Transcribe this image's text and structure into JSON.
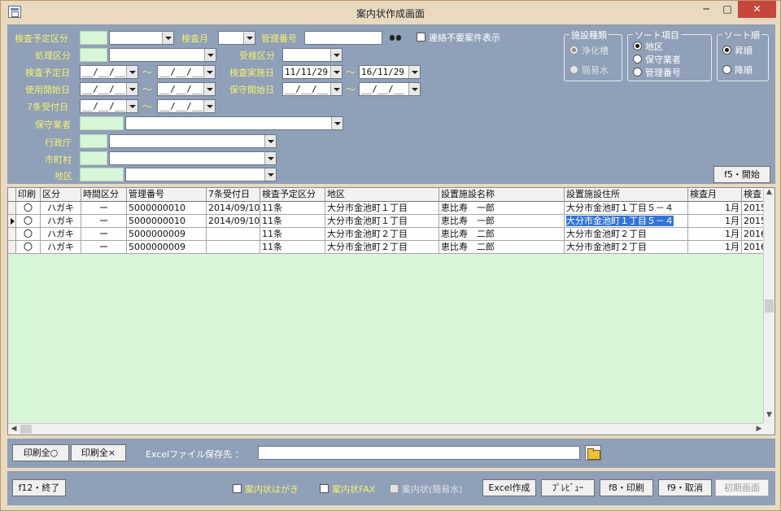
{
  "window": {
    "title": "案内状作成画面",
    "min_label": "─",
    "max_label": "□",
    "close_label": "✕"
  },
  "search": {
    "kensa_yotei_kubun": "検査予定区分",
    "kensa_tsuki": "検査月",
    "kanri_bangou": "管理番号",
    "renraku_fuyou": "連絡不要案件表示",
    "shori_kubun": "処理区分",
    "juken_kubun": "受検区分",
    "kensa_yotei_bi": "検査予定日",
    "kensa_jisshi_bi": "検査実施日",
    "shiyou_kaishi_bi": "使用開始日",
    "hoshu_kaishi_bi": "保守開始日",
    "nanajou_uketsuke_bi": "7条受付日",
    "hoshu_gyousha": "保守業者",
    "gyouseichou": "行政庁",
    "shichouson": "市町村",
    "chiku": "地区",
    "blank_date": "__/__/__",
    "jisshi_from": "11/11/29",
    "jisshi_to": "16/11/29",
    "tilde": "～"
  },
  "shisetsu_group": {
    "title": "施設種類",
    "options": [
      "浄化槽",
      "簡易水"
    ]
  },
  "sort_group": {
    "title": "ソート項目",
    "options": [
      "地区",
      "保守業者",
      "管理番号"
    ]
  },
  "order_group": {
    "title": "ソート順",
    "options": [
      "昇順",
      "降順"
    ]
  },
  "buttons": {
    "start": "f5・開始",
    "print_all_on": "印刷全○",
    "print_all_off": "印刷全×",
    "end": "f12・終了",
    "excel": "Excel作成",
    "preview": "ﾌﾟﾚﾋﾞｭｰ",
    "print": "f8・印刷",
    "cancel": "f9・取消",
    "init": "初期画面"
  },
  "excel": {
    "label": "Excelファイル保存先 ：",
    "value": ""
  },
  "footer_checks": [
    "案内状はがき",
    "案内状FAX",
    "案内状(簡易水)"
  ],
  "grid": {
    "columns": [
      "印刷",
      "区分",
      "時間区分",
      "管理番号",
      "7条受付日",
      "検査予定区分",
      "地区",
      "設置施設名称",
      "設置施設住所",
      "検査月",
      "検査"
    ],
    "rows": [
      [
        "〇",
        "ハガキ",
        "ー",
        "5000000010",
        "2014/09/10",
        "11条",
        "大分市金池町１丁目",
        "恵比寿　一郎",
        "大分市金池町１丁目５－４",
        "1月",
        "2015"
      ],
      [
        "〇",
        "ハガキ",
        "ー",
        "5000000010",
        "2014/09/10",
        "11条",
        "大分市金池町１丁目",
        "恵比寿　一郎",
        "大分市金池町１丁目５－４",
        "1月",
        "2015"
      ],
      [
        "〇",
        "ハガキ",
        "ー",
        "5000000009",
        "",
        "11条",
        "大分市金池町２丁目",
        "恵比寿　二郎",
        "大分市金池町２丁目",
        "1月",
        "2016"
      ],
      [
        "〇",
        "ハガキ",
        "ー",
        "5000000009",
        "",
        "11条",
        "大分市金池町２丁目",
        "恵比寿　二郎",
        "大分市金池町２丁目",
        "1月",
        "2016"
      ]
    ]
  }
}
